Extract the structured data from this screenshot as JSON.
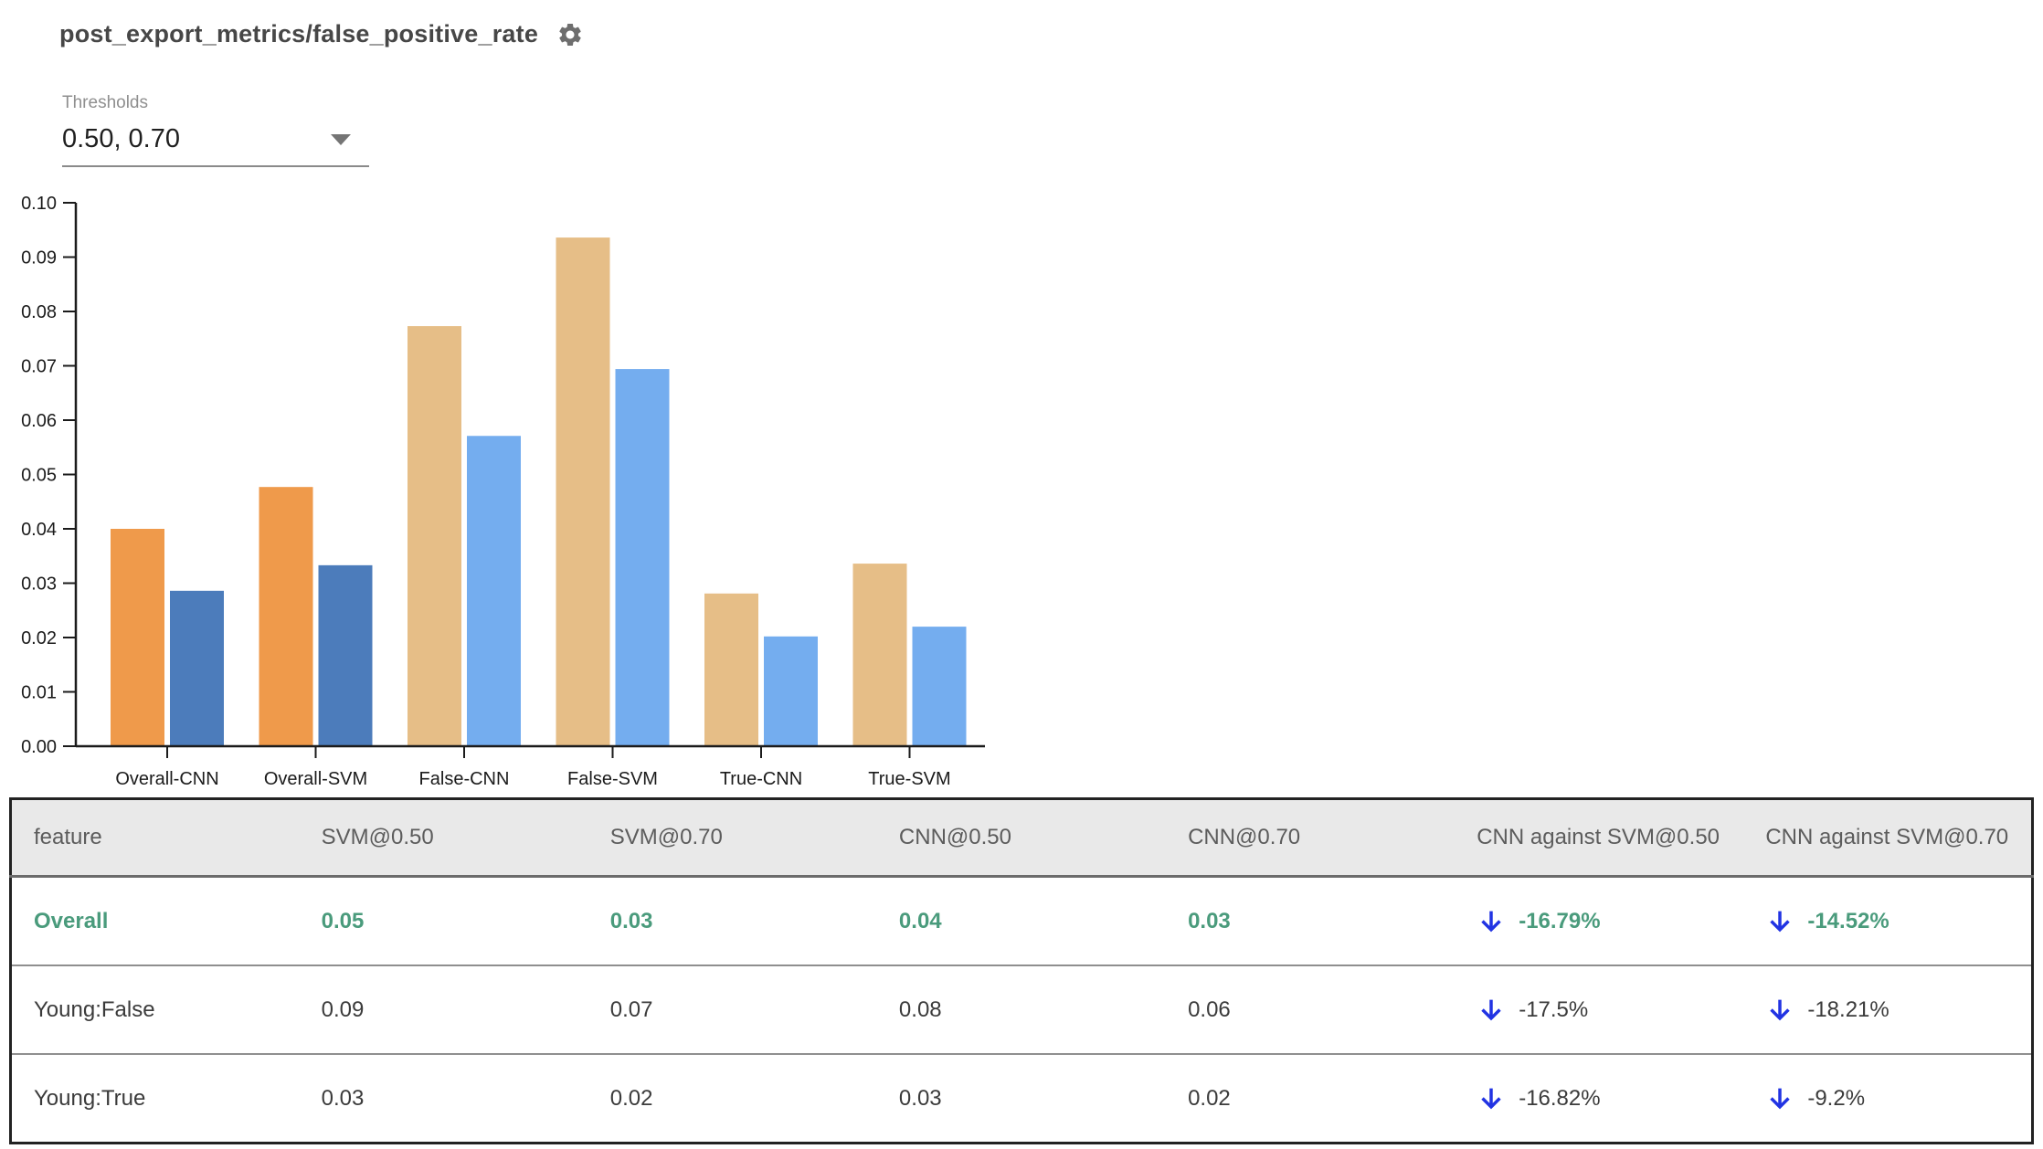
{
  "header": {
    "title": "post_export_metrics/false_positive_rate",
    "settings_icon": "gear-icon"
  },
  "thresholds": {
    "label": "Thresholds",
    "value": "0.50, 0.70"
  },
  "colors": {
    "overall_bar_t050": "#EF9A4B",
    "overall_bar_t070": "#4C7CBB",
    "slice_bar_t050": "#E6BE87",
    "slice_bar_t070": "#74ADEF",
    "highlight_green": "#4A9B7C",
    "arrow_blue": "#2133E3",
    "header_bg": "#E9E9E9"
  },
  "chart_data": {
    "type": "bar",
    "title": "",
    "xlabel": "",
    "ylabel": "",
    "categories": [
      "Overall-CNN",
      "Overall-SVM",
      "False-CNN",
      "False-SVM",
      "True-CNN",
      "True-SVM"
    ],
    "series": [
      {
        "name": "threshold 0.50",
        "values": [
          0.04,
          0.0477,
          0.0773,
          0.0936,
          0.0281,
          0.0336
        ]
      },
      {
        "name": "threshold 0.70",
        "values": [
          0.0286,
          0.0333,
          0.0571,
          0.0694,
          0.0202,
          0.022
        ]
      }
    ],
    "bar_colors": [
      [
        "#EF9A4B",
        "#4C7CBB"
      ],
      [
        "#EF9A4B",
        "#4C7CBB"
      ],
      [
        "#E6BE87",
        "#74ADEF"
      ],
      [
        "#E6BE87",
        "#74ADEF"
      ],
      [
        "#E6BE87",
        "#74ADEF"
      ],
      [
        "#E6BE87",
        "#74ADEF"
      ]
    ],
    "ylim": [
      0,
      0.1
    ],
    "ytick_step": 0.01,
    "ytick_labels": [
      "0.00",
      "0.01",
      "0.02",
      "0.03",
      "0.04",
      "0.05",
      "0.06",
      "0.07",
      "0.08",
      "0.09",
      "0.10"
    ],
    "grid": false,
    "legend": "none"
  },
  "table": {
    "columns": [
      "feature",
      "SVM@0.50",
      "SVM@0.70",
      "CNN@0.50",
      "CNN@0.70",
      "CNN against SVM@0.50",
      "CNN against SVM@0.70"
    ],
    "rows": [
      {
        "feature": "Overall",
        "values": [
          "0.05",
          "0.03",
          "0.04",
          "0.03"
        ],
        "comparisons": [
          {
            "direction": "down",
            "text": "-16.79%"
          },
          {
            "direction": "down",
            "text": "-14.52%"
          }
        ],
        "highlight": true
      },
      {
        "feature": "Young:False",
        "values": [
          "0.09",
          "0.07",
          "0.08",
          "0.06"
        ],
        "comparisons": [
          {
            "direction": "down",
            "text": "-17.5%"
          },
          {
            "direction": "down",
            "text": "-18.21%"
          }
        ],
        "highlight": false
      },
      {
        "feature": "Young:True",
        "values": [
          "0.03",
          "0.02",
          "0.03",
          "0.02"
        ],
        "comparisons": [
          {
            "direction": "down",
            "text": "-16.82%"
          },
          {
            "direction": "down",
            "text": "-9.2%"
          }
        ],
        "highlight": false
      }
    ]
  }
}
